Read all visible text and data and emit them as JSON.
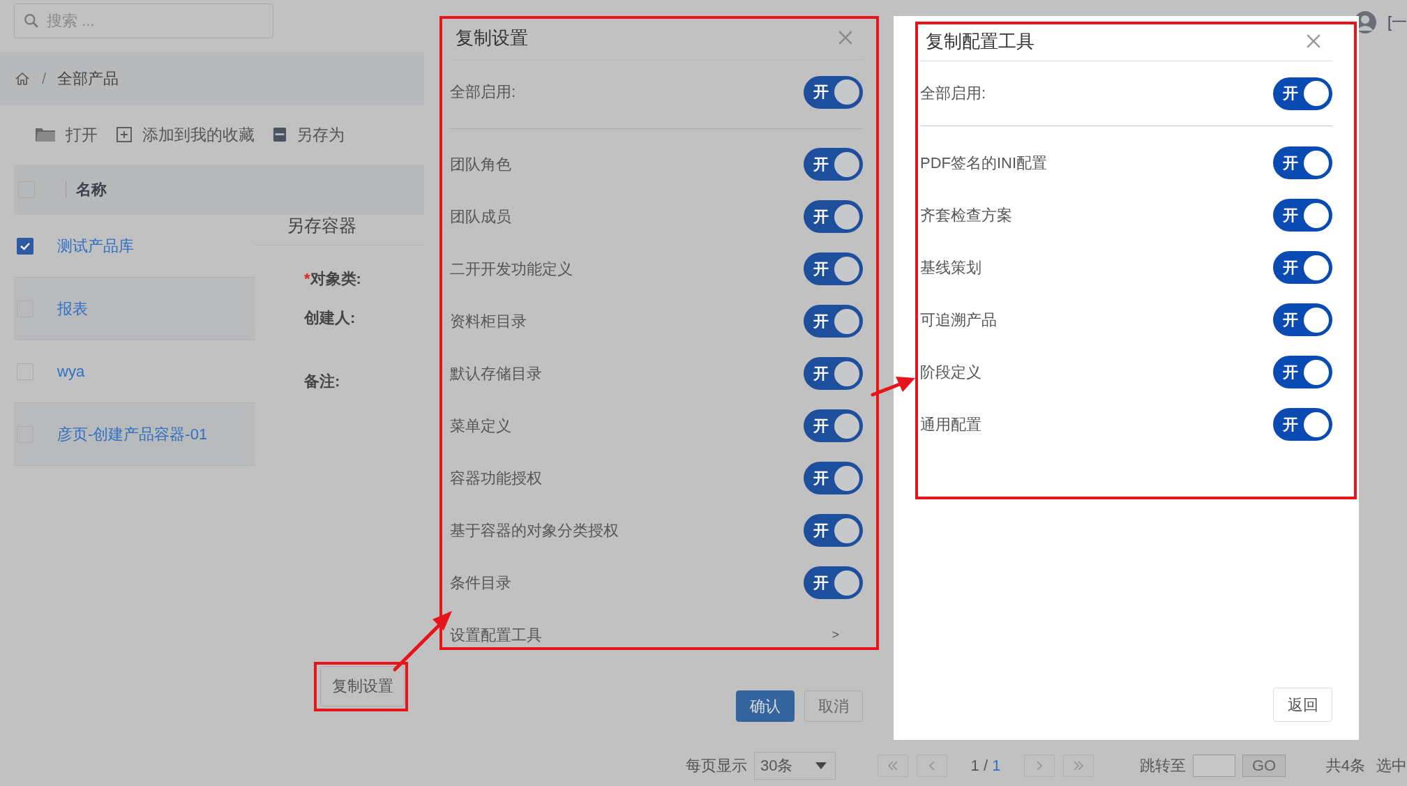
{
  "search": {
    "placeholder": "搜索 ..."
  },
  "breadcrumb": {
    "separator": "/",
    "current": "全部产品"
  },
  "toolbar": [
    {
      "kind": "open",
      "label": "打开"
    },
    {
      "kind": "favorite",
      "label": "添加到我的收藏"
    },
    {
      "kind": "save",
      "label": "另存为"
    }
  ],
  "table": {
    "columns": [
      "名称"
    ],
    "header_checked": false,
    "rows": [
      {
        "name": "测试产品库",
        "selected": true
      },
      {
        "name": "报表",
        "selected": false
      },
      {
        "name": "wya",
        "selected": false
      },
      {
        "name": "彦页-创建产品容器-01",
        "selected": false
      }
    ]
  },
  "save_panel": {
    "title": "另存容器",
    "fields": [
      {
        "label": "对象类:",
        "required": true,
        "required_mark": "*"
      },
      {
        "label": "创建人:"
      },
      {
        "label": "备注:"
      }
    ]
  },
  "copy_button": "复制设置",
  "header": {
    "user_text": "[一"
  },
  "copy_dialog": {
    "title": "复制设置",
    "enable_all": {
      "label": "全部启用:",
      "on": true,
      "toggle_text": "开"
    },
    "items": [
      {
        "label": "团队角色",
        "on": true,
        "toggle_text": "开"
      },
      {
        "label": "团队成员",
        "on": true,
        "toggle_text": "开"
      },
      {
        "label": "二开开发功能定义",
        "on": true,
        "toggle_text": "开"
      },
      {
        "label": "资料柜目录",
        "on": true,
        "toggle_text": "开"
      },
      {
        "label": "默认存储目录",
        "on": true,
        "toggle_text": "开"
      },
      {
        "label": "菜单定义",
        "on": true,
        "toggle_text": "开"
      },
      {
        "label": "容器功能授权",
        "on": true,
        "toggle_text": "开"
      },
      {
        "label": "基于容器的对象分类授权",
        "on": true,
        "toggle_text": "开"
      },
      {
        "label": "条件目录",
        "on": true,
        "toggle_text": "开"
      }
    ],
    "link": {
      "label": "设置配置工具",
      "caret": ">"
    },
    "buttons": [
      {
        "label": "确认",
        "primary": true
      },
      {
        "label": "取消",
        "primary": false
      }
    ]
  },
  "tool_dialog": {
    "title": "复制配置工具",
    "enable_all": {
      "label": "全部启用:",
      "on": true,
      "toggle_text": "开"
    },
    "items": [
      {
        "label": "PDF签名的INI配置",
        "on": true,
        "toggle_text": "开"
      },
      {
        "label": "齐套检查方案",
        "on": true,
        "toggle_text": "开"
      },
      {
        "label": "基线策划",
        "on": true,
        "toggle_text": "开"
      },
      {
        "label": "可追溯产品",
        "on": true,
        "toggle_text": "开"
      },
      {
        "label": "阶段定义",
        "on": true,
        "toggle_text": "开"
      },
      {
        "label": "通用配置",
        "on": true,
        "toggle_text": "开"
      }
    ],
    "back_button": "返回"
  },
  "pagination": {
    "page_size_label": "每页显示",
    "page_size": "30条",
    "page": "1",
    "separator": "/",
    "pages": "1",
    "jump_label": "跳转至",
    "go": "GO",
    "total": "共4条",
    "selected_text": "选中"
  }
}
